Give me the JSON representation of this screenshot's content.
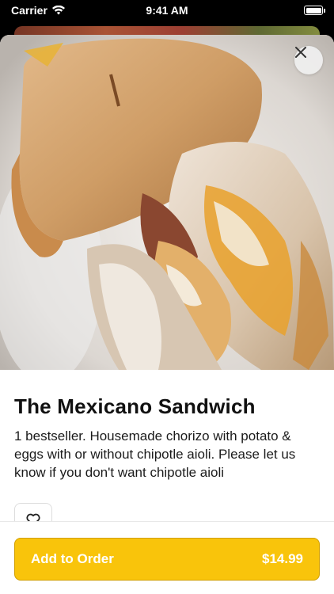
{
  "status_bar": {
    "carrier": "Carrier",
    "time": "9:41 AM"
  },
  "item": {
    "name": "The Mexicano Sandwich",
    "description": "1 bestseller. Housemade chorizo with potato & eggs with or without chipotle aioli. Please let us know if you don't want chipotle aioli",
    "image_icon": "sandwich-photo"
  },
  "actions": {
    "close_icon": "close-icon",
    "favorite_icon": "heart-icon",
    "add_label": "Add to Order",
    "price": "$14.99"
  },
  "colors": {
    "accent": "#f9c40b",
    "accent_border": "#d19f00"
  }
}
